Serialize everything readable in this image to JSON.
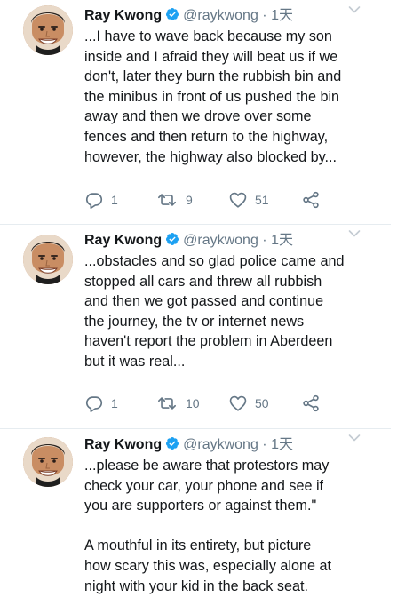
{
  "tweets": [
    {
      "name": "Ray Kwong",
      "handle": "@raykwong",
      "separator": "·",
      "time": "1天",
      "text": "...I have to wave back because my son\ninside and I afraid they will beat us if we\ndon't, later they burn the rubbish bin and\nthe minibus in front of us pushed the bin\naway and then we drove over some\nfences and then return to the highway,\nhowever, the highway also blocked by...",
      "replies": "1",
      "retweets": "9",
      "likes": "51"
    },
    {
      "name": "Ray Kwong",
      "handle": "@raykwong",
      "separator": "·",
      "time": "1天",
      "text": "...obstacles and so glad police came and\nstopped all cars and threw all rubbish\nand then we got passed and continue\nthe journey, the tv or internet news\nhaven't report the problem in Aberdeen\nbut it was real...",
      "replies": "1",
      "retweets": "10",
      "likes": "50"
    },
    {
      "name": "Ray Kwong",
      "handle": "@raykwong",
      "separator": "·",
      "time": "1天",
      "text": "...please be aware that protestors may\ncheck your car, your phone and see if\nyou are supporters or against them.\"\n\nA mouthful in its entirety, but picture\nhow scary this was, especially alone at\nnight with your kid in the back seat."
    }
  ],
  "colors": {
    "verified": "#1da1f2",
    "secondary_text": "#657786",
    "divider": "#e6ecf0"
  },
  "icons": [
    "verified-badge-icon",
    "chevron-down-icon",
    "reply-icon",
    "retweet-icon",
    "like-icon",
    "share-icon",
    "avatar-photo"
  ]
}
